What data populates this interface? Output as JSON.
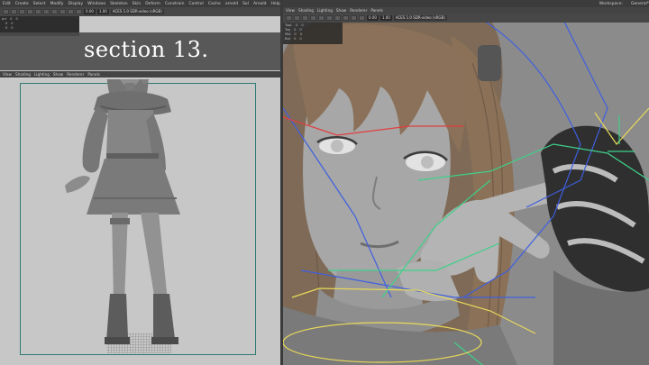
{
  "banner": {
    "text": "section 13."
  },
  "left_window": {
    "menu": [
      "Edit",
      "Create",
      "Select",
      "Modify",
      "Display",
      "Windows",
      "Skeleton",
      "Skin",
      "Deform",
      "Constrain",
      "Control",
      "Cache",
      "arnold",
      "Sol",
      "Arnold",
      "Help"
    ],
    "toolbar": {
      "value_a": "0.00",
      "value_b": "1.00",
      "colorspace": "ACES 1.0 SDR-video (sRGB)"
    },
    "outliner_rows": [
      {
        "name": "prt",
        "a": "0",
        "b": "0"
      },
      {
        "name": "",
        "a": "0",
        "b": "0"
      },
      {
        "name": "",
        "a": "0",
        "b": "0"
      }
    ],
    "panel_menu": [
      "View",
      "Shading",
      "Lighting",
      "Show",
      "Renderer",
      "Panels"
    ]
  },
  "right_window": {
    "workspace": {
      "label": "Workspace:",
      "value": "General*"
    },
    "panel_menu": [
      "View",
      "Shading",
      "Lighting",
      "Show",
      "Renderer",
      "Panels"
    ],
    "toolbar": {
      "value_a": "0.00",
      "value_b": "1.00",
      "colorspace": "ACES 1.0 SDR-video (sRGB)"
    },
    "outliner_rows": [
      {
        "name": "TopL",
        "a": "0",
        "b": "0"
      },
      {
        "name": "Top",
        "a": "0",
        "b": "0"
      },
      {
        "name": "Mid",
        "a": "0",
        "b": "0"
      },
      {
        "name": "Bot",
        "a": "0",
        "b": "0"
      }
    ]
  },
  "colors": {
    "banner_bg": "#4b4b4b",
    "viewport_left": "#c7c7c7",
    "viewport_right": "#8b8b8b",
    "resolution_gate": "#2e7c72",
    "rig_curve_yellow": "#e8d95a",
    "rig_curve_green": "#3fd08a",
    "rig_curve_blue": "#3f5fe0",
    "rig_curve_red": "#e03f3f"
  }
}
